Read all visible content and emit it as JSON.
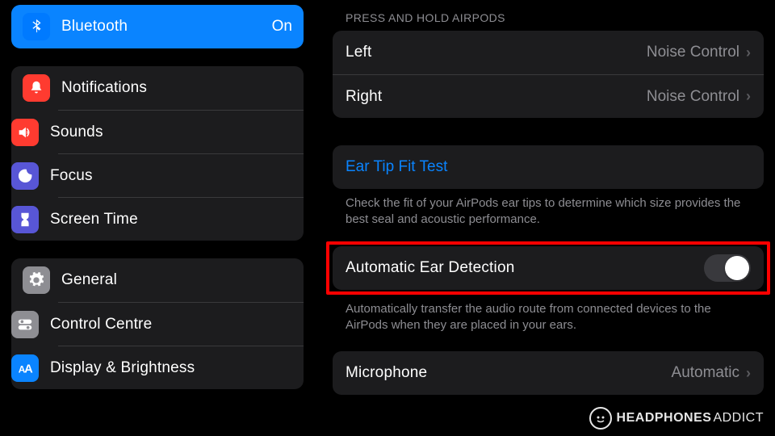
{
  "sidebar": {
    "selected": {
      "label": "Bluetooth",
      "value": "On"
    },
    "group1": [
      {
        "label": "Notifications"
      },
      {
        "label": "Sounds"
      },
      {
        "label": "Focus"
      },
      {
        "label": "Screen Time"
      }
    ],
    "group2": [
      {
        "label": "General"
      },
      {
        "label": "Control Centre"
      },
      {
        "label": "Display & Brightness"
      }
    ]
  },
  "main": {
    "press_hold_header": "PRESS AND HOLD AIRPODS",
    "left": {
      "label": "Left",
      "value": "Noise Control"
    },
    "right": {
      "label": "Right",
      "value": "Noise Control"
    },
    "ear_tip": {
      "label": "Ear Tip Fit Test"
    },
    "ear_tip_footer": "Check the fit of your AirPods ear tips to determine which size provides the best seal and acoustic performance.",
    "auto_ear": {
      "label": "Automatic Ear Detection"
    },
    "auto_ear_footer": "Automatically transfer the audio route from connected devices to the AirPods when they are placed in your ears.",
    "microphone": {
      "label": "Microphone",
      "value": "Automatic"
    }
  },
  "watermark": {
    "t1": "HEADPHONES",
    "t2": "ADDICT"
  }
}
